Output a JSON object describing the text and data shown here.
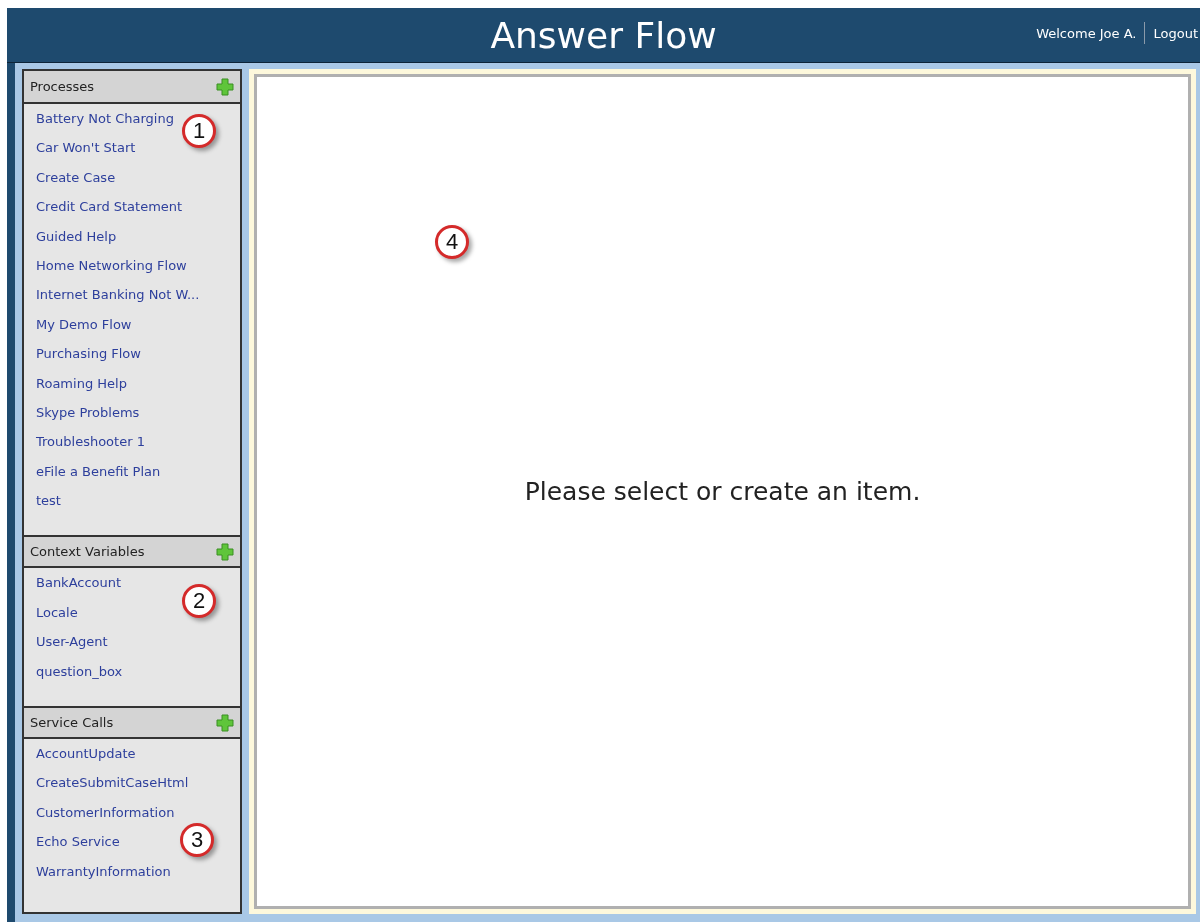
{
  "header": {
    "title": "Answer Flow",
    "welcome": "Welcome Joe A.",
    "logout": "Logout"
  },
  "sections": [
    {
      "title": "Processes",
      "callout": "1",
      "items": [
        "Battery Not Charging",
        "Car Won't Start",
        "Create Case",
        "Credit Card Statement",
        "Guided Help",
        "Home Networking Flow",
        "Internet Banking Not W...",
        "My Demo Flow",
        "Purchasing Flow",
        "Roaming Help",
        "Skype Problems",
        "Troubleshooter 1",
        "eFile a Benefit Plan",
        "test"
      ]
    },
    {
      "title": "Context Variables",
      "callout": "2",
      "items": [
        "BankAccount",
        "Locale",
        "User-Agent",
        "question_box"
      ]
    },
    {
      "title": "Service Calls",
      "callout": "3",
      "items": [
        "AccountUpdate",
        "CreateSubmitCaseHtml",
        "CustomerInformation",
        "Echo Service",
        "WarrantyInformation"
      ]
    }
  ],
  "main": {
    "message": "Please select or create an item.",
    "callout": "4"
  }
}
